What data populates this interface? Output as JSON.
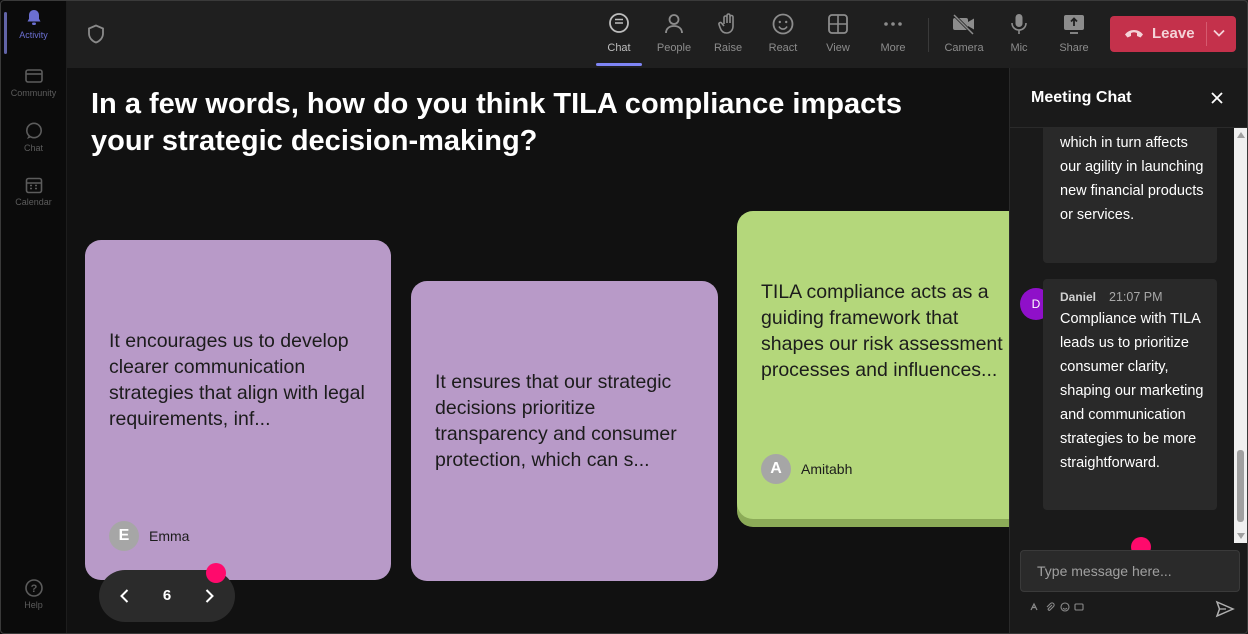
{
  "rail": {
    "items": [
      {
        "label": "Activity",
        "icon": "bell-icon",
        "active": true
      },
      {
        "label": "Community",
        "icon": "community-icon"
      },
      {
        "label": "Chat",
        "icon": "chat-icon"
      },
      {
        "label": "Calendar",
        "icon": "calendar-icon"
      }
    ],
    "help_label": "Help"
  },
  "toolbar": {
    "chat": "Chat",
    "people": "People",
    "raise": "Raise",
    "react": "React",
    "view": "View",
    "more": "More",
    "camera": "Camera",
    "mic": "Mic",
    "share": "Share",
    "leave": "Leave"
  },
  "stage": {
    "question": "In a few words, how do you think TILA compliance impacts your strategic decision-making?",
    "cards": [
      {
        "text": "It encourages us to develop clearer communication strategies that align with legal requirements, inf...",
        "initial": "E",
        "author": "Emma",
        "color": "#b89ac8"
      },
      {
        "text": "It ensures that our strategic decisions prioritize transparency and consumer protection, which can s...",
        "color": "#b89ac8"
      },
      {
        "text": "TILA compliance acts as a guiding framework that shapes our risk assessment processes and influences...",
        "initial": "A",
        "author": "Amitabh",
        "color": "#b4d77b"
      }
    ],
    "page": "6"
  },
  "chat": {
    "title": "Meeting Chat",
    "messages": [
      {
        "text": "which in turn affects our agility in launching new financial products or services."
      },
      {
        "sender": "Daniel",
        "initial": "D",
        "time": "21:07 PM",
        "text": "Compliance with TILA leads us to prioritize consumer clarity, shaping our marketing and communication strategies to be more straightforward."
      }
    ],
    "input_placeholder": "Type message here..."
  },
  "colors": {
    "accent": "#7f85f5",
    "leave": "#c4314b",
    "marker": "#ff0a6c",
    "avatar_d": "#8f10c9"
  }
}
